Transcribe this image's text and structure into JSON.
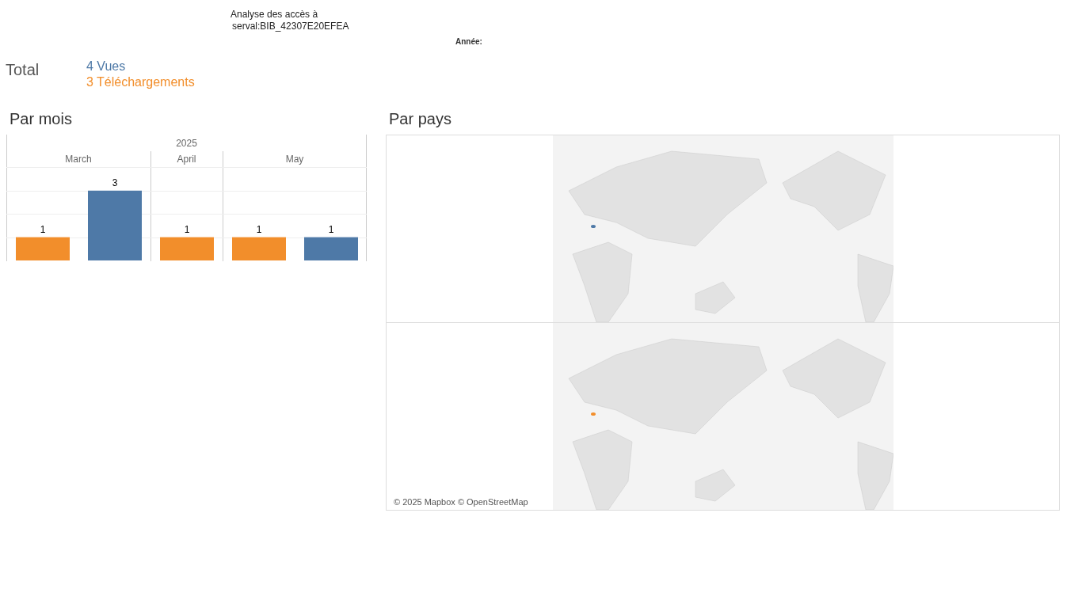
{
  "title": {
    "line_1": "Analyse des accès à",
    "line_2": "serval:BIB_42307E20EFEA"
  },
  "filter": {
    "label": "Année:"
  },
  "total": {
    "label": "Total",
    "items": [
      {
        "text": "4 Vues",
        "color": "#4e79a7"
      },
      {
        "text": "3 Téléchargements",
        "color": "#f28e2b"
      }
    ]
  },
  "by_month": {
    "heading": "Par mois",
    "year": "2025",
    "chart_data": {
      "type": "bar",
      "categories": [
        "March",
        "April",
        "May"
      ],
      "series": [
        {
          "color": "#f28e2b",
          "values": [
            1,
            1,
            1
          ]
        },
        {
          "color": "#4e79a7",
          "values": [
            3,
            null,
            1
          ]
        }
      ],
      "data_labels": true
    }
  },
  "by_country": {
    "heading": "Par pays",
    "maps": [
      {
        "color": "#4e79a7"
      },
      {
        "color": "#f28e2b"
      }
    ],
    "attribution": "© 2025 Mapbox © OpenStreetMap"
  }
}
